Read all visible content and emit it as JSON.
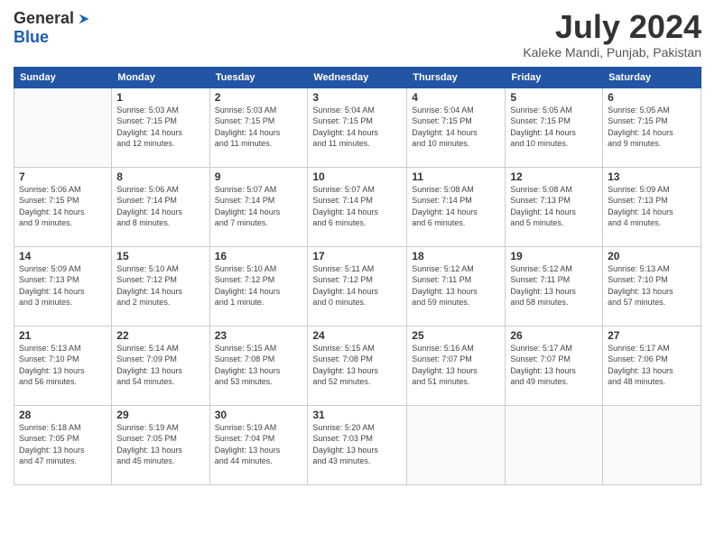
{
  "header": {
    "logo_general": "General",
    "logo_blue": "Blue",
    "month_title": "July 2024",
    "location": "Kaleke Mandi, Punjab, Pakistan"
  },
  "weekdays": [
    "Sunday",
    "Monday",
    "Tuesday",
    "Wednesday",
    "Thursday",
    "Friday",
    "Saturday"
  ],
  "weeks": [
    [
      {
        "day": "",
        "info": ""
      },
      {
        "day": "1",
        "info": "Sunrise: 5:03 AM\nSunset: 7:15 PM\nDaylight: 14 hours\nand 12 minutes."
      },
      {
        "day": "2",
        "info": "Sunrise: 5:03 AM\nSunset: 7:15 PM\nDaylight: 14 hours\nand 11 minutes."
      },
      {
        "day": "3",
        "info": "Sunrise: 5:04 AM\nSunset: 7:15 PM\nDaylight: 14 hours\nand 11 minutes."
      },
      {
        "day": "4",
        "info": "Sunrise: 5:04 AM\nSunset: 7:15 PM\nDaylight: 14 hours\nand 10 minutes."
      },
      {
        "day": "5",
        "info": "Sunrise: 5:05 AM\nSunset: 7:15 PM\nDaylight: 14 hours\nand 10 minutes."
      },
      {
        "day": "6",
        "info": "Sunrise: 5:05 AM\nSunset: 7:15 PM\nDaylight: 14 hours\nand 9 minutes."
      }
    ],
    [
      {
        "day": "7",
        "info": "Sunrise: 5:06 AM\nSunset: 7:15 PM\nDaylight: 14 hours\nand 9 minutes."
      },
      {
        "day": "8",
        "info": "Sunrise: 5:06 AM\nSunset: 7:14 PM\nDaylight: 14 hours\nand 8 minutes."
      },
      {
        "day": "9",
        "info": "Sunrise: 5:07 AM\nSunset: 7:14 PM\nDaylight: 14 hours\nand 7 minutes."
      },
      {
        "day": "10",
        "info": "Sunrise: 5:07 AM\nSunset: 7:14 PM\nDaylight: 14 hours\nand 6 minutes."
      },
      {
        "day": "11",
        "info": "Sunrise: 5:08 AM\nSunset: 7:14 PM\nDaylight: 14 hours\nand 6 minutes."
      },
      {
        "day": "12",
        "info": "Sunrise: 5:08 AM\nSunset: 7:13 PM\nDaylight: 14 hours\nand 5 minutes."
      },
      {
        "day": "13",
        "info": "Sunrise: 5:09 AM\nSunset: 7:13 PM\nDaylight: 14 hours\nand 4 minutes."
      }
    ],
    [
      {
        "day": "14",
        "info": "Sunrise: 5:09 AM\nSunset: 7:13 PM\nDaylight: 14 hours\nand 3 minutes."
      },
      {
        "day": "15",
        "info": "Sunrise: 5:10 AM\nSunset: 7:12 PM\nDaylight: 14 hours\nand 2 minutes."
      },
      {
        "day": "16",
        "info": "Sunrise: 5:10 AM\nSunset: 7:12 PM\nDaylight: 14 hours\nand 1 minute."
      },
      {
        "day": "17",
        "info": "Sunrise: 5:11 AM\nSunset: 7:12 PM\nDaylight: 14 hours\nand 0 minutes."
      },
      {
        "day": "18",
        "info": "Sunrise: 5:12 AM\nSunset: 7:11 PM\nDaylight: 13 hours\nand 59 minutes."
      },
      {
        "day": "19",
        "info": "Sunrise: 5:12 AM\nSunset: 7:11 PM\nDaylight: 13 hours\nand 58 minutes."
      },
      {
        "day": "20",
        "info": "Sunrise: 5:13 AM\nSunset: 7:10 PM\nDaylight: 13 hours\nand 57 minutes."
      }
    ],
    [
      {
        "day": "21",
        "info": "Sunrise: 5:13 AM\nSunset: 7:10 PM\nDaylight: 13 hours\nand 56 minutes."
      },
      {
        "day": "22",
        "info": "Sunrise: 5:14 AM\nSunset: 7:09 PM\nDaylight: 13 hours\nand 54 minutes."
      },
      {
        "day": "23",
        "info": "Sunrise: 5:15 AM\nSunset: 7:08 PM\nDaylight: 13 hours\nand 53 minutes."
      },
      {
        "day": "24",
        "info": "Sunrise: 5:15 AM\nSunset: 7:08 PM\nDaylight: 13 hours\nand 52 minutes."
      },
      {
        "day": "25",
        "info": "Sunrise: 5:16 AM\nSunset: 7:07 PM\nDaylight: 13 hours\nand 51 minutes."
      },
      {
        "day": "26",
        "info": "Sunrise: 5:17 AM\nSunset: 7:07 PM\nDaylight: 13 hours\nand 49 minutes."
      },
      {
        "day": "27",
        "info": "Sunrise: 5:17 AM\nSunset: 7:06 PM\nDaylight: 13 hours\nand 48 minutes."
      }
    ],
    [
      {
        "day": "28",
        "info": "Sunrise: 5:18 AM\nSunset: 7:05 PM\nDaylight: 13 hours\nand 47 minutes."
      },
      {
        "day": "29",
        "info": "Sunrise: 5:19 AM\nSunset: 7:05 PM\nDaylight: 13 hours\nand 45 minutes."
      },
      {
        "day": "30",
        "info": "Sunrise: 5:19 AM\nSunset: 7:04 PM\nDaylight: 13 hours\nand 44 minutes."
      },
      {
        "day": "31",
        "info": "Sunrise: 5:20 AM\nSunset: 7:03 PM\nDaylight: 13 hours\nand 43 minutes."
      },
      {
        "day": "",
        "info": ""
      },
      {
        "day": "",
        "info": ""
      },
      {
        "day": "",
        "info": ""
      }
    ]
  ]
}
